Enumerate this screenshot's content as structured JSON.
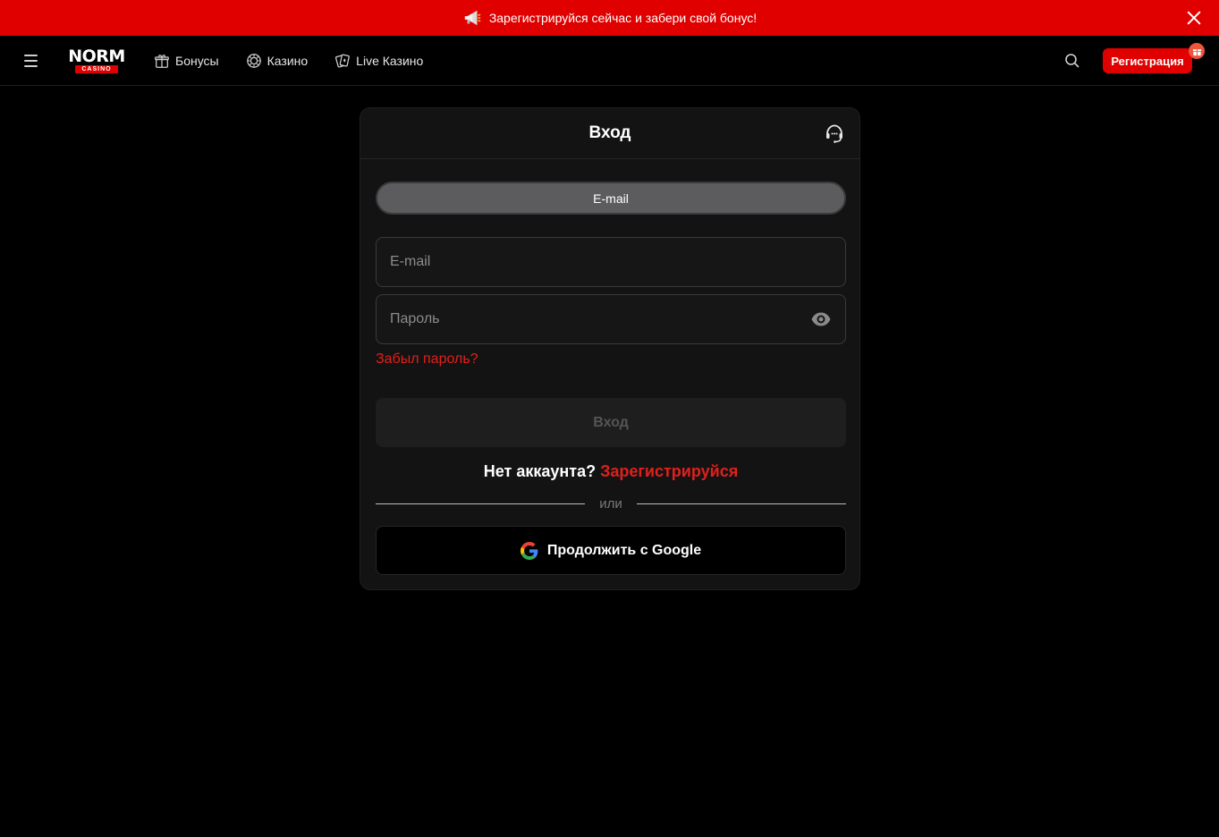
{
  "promo": {
    "text": "Зарегистрируйся сейчас и забери свой бонус!",
    "icon": "megaphone-icon",
    "close_icon": "close-icon"
  },
  "header": {
    "logo": {
      "top": "NORM",
      "bottom": "CASINO"
    },
    "nav": [
      {
        "label": "Бонусы",
        "icon": "gift-icon"
      },
      {
        "label": "Казино",
        "icon": "chip-icon"
      },
      {
        "label": "Live Казино",
        "icon": "cards-icon"
      }
    ],
    "register_label": "Регистрация"
  },
  "login": {
    "title": "Вход",
    "tab_label": "E-mail",
    "email_placeholder": "E-mail",
    "password_placeholder": "Пароль",
    "forgot_label": "Забыл пароль?",
    "submit_label": "Вход",
    "no_account_label": "Нет аккаунта?",
    "register_link": "Зарегистрируйся",
    "divider_text": "или",
    "google_label": "Продолжить с Google"
  },
  "colors": {
    "accent": "#e00000",
    "link": "#e0201c",
    "background": "#000000",
    "card": "#131313"
  }
}
